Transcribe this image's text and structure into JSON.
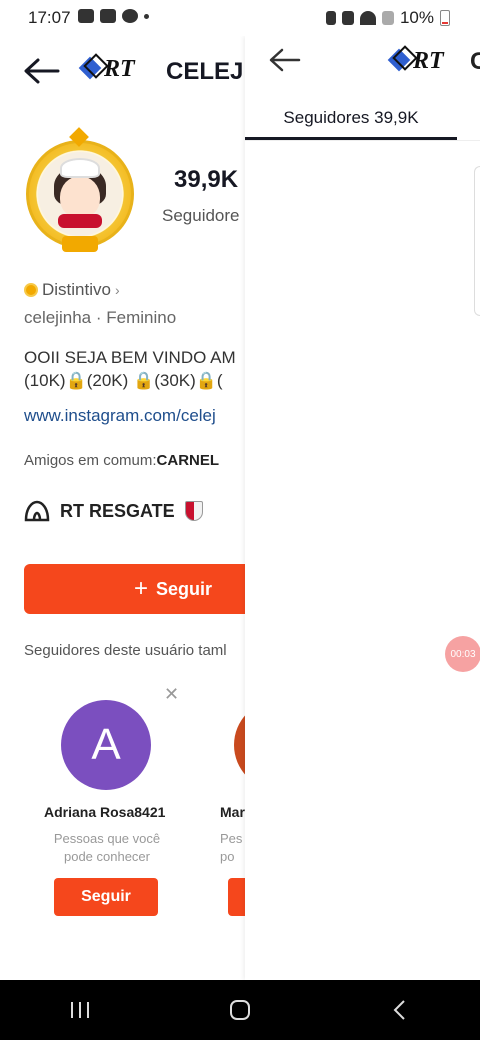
{
  "status_bar": {
    "time": "17:07",
    "battery": "10%"
  },
  "profile": {
    "brand": "RT",
    "name": "CELEJ",
    "followers_count": "39,9K",
    "followers_label": "Seguidore",
    "badge_label": "Distintivo",
    "handle": "celejinha",
    "gender": "Feminino",
    "bio_line1": "OOII SEJA BEM VINDO AM",
    "bio_line2": "(10K)🔒(20K) 🔒(30K)🔒(",
    "link": "www.instagram.com/celej",
    "friends_prefix": "Amigos em comum:",
    "friends_names": "CARNEL",
    "group_name": "RT RESGATE",
    "follow_label": "Seguir",
    "suggest_label": "Seguidores deste usuário taml"
  },
  "suggestions": [
    {
      "initial": "A",
      "name": "Adriana Rosa8421",
      "subtitle": "Pessoas que você pode conhecer",
      "button": "Seguir"
    },
    {
      "name": "Mar",
      "subtitle": "Pes\npo"
    }
  ],
  "right_panel": {
    "brand": "RT",
    "name": "C",
    "tab_label": "Seguidores 39,9K",
    "recording_time": "00:03"
  },
  "colors": {
    "accent": "#f5471c",
    "link": "#1f4e8c",
    "avatar_bg": "#7b4fbf"
  }
}
